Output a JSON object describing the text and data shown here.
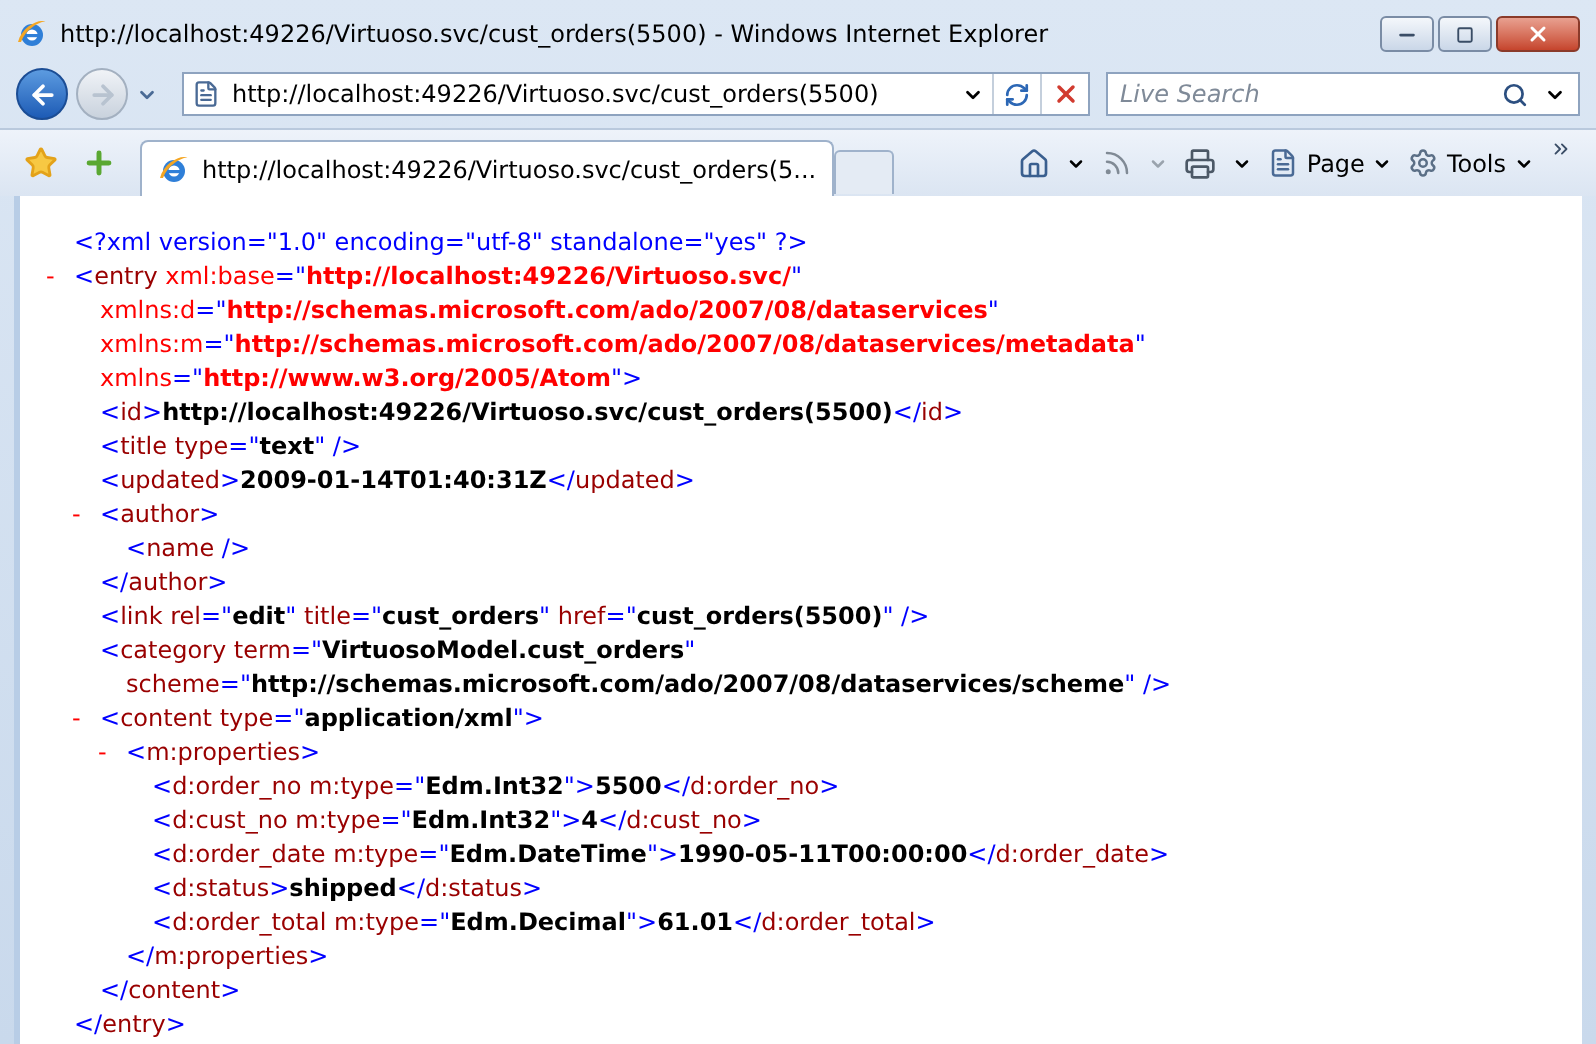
{
  "window": {
    "title": "http://localhost:49226/Virtuoso.svc/cust_orders(5500) - Windows Internet Explorer"
  },
  "address_bar": {
    "value": "http://localhost:49226/Virtuoso.svc/cust_orders(5500)"
  },
  "search": {
    "placeholder": "Live Search"
  },
  "tabs": [
    {
      "label": "http://localhost:49226/Virtuoso.svc/cust_orders(5...",
      "selected": true
    }
  ],
  "toolbar": {
    "page": "Page",
    "tools": "Tools"
  },
  "xml": [
    {
      "lines": [
        [
          {
            "kind": "p",
            "text": "<?xml version=\"1.0\" encoding=\"utf-8\" standalone=\"yes\" ?>"
          }
        ]
      ]
    },
    {
      "toggle": "-",
      "lines": [
        [
          {
            "kind": "p",
            "text": "<"
          },
          {
            "kind": "n",
            "text": "entry"
          },
          {
            "kind": "ns",
            "text": " xml:base"
          },
          {
            "kind": "p",
            "text": "=\""
          },
          {
            "kind": "nsv",
            "text": "http://localhost:49226/Virtuoso.svc/"
          },
          {
            "kind": "p",
            "text": "\""
          }
        ],
        [
          {
            "kind": "ns",
            "text": "xmlns:d"
          },
          {
            "kind": "p",
            "text": "=\""
          },
          {
            "kind": "nsv",
            "text": "http://schemas.microsoft.com/ado/2007/08/dataservices"
          },
          {
            "kind": "p",
            "text": "\""
          }
        ],
        [
          {
            "kind": "ns",
            "text": "xmlns:m"
          },
          {
            "kind": "p",
            "text": "=\""
          },
          {
            "kind": "nsv",
            "text": "http://schemas.microsoft.com/ado/2007/08/dataservices/metadata"
          },
          {
            "kind": "p",
            "text": "\""
          }
        ],
        [
          {
            "kind": "ns",
            "text": "xmlns"
          },
          {
            "kind": "p",
            "text": "=\""
          },
          {
            "kind": "nsv",
            "text": "http://www.w3.org/2005/Atom"
          },
          {
            "kind": "p",
            "text": "\">"
          }
        ]
      ],
      "children": [
        {
          "lines": [
            [
              {
                "kind": "p",
                "text": "<"
              },
              {
                "kind": "n",
                "text": "id"
              },
              {
                "kind": "p",
                "text": ">"
              },
              {
                "kind": "v",
                "text": "http://localhost:49226/Virtuoso.svc/cust_orders(5500)"
              },
              {
                "kind": "p",
                "text": "</"
              },
              {
                "kind": "n",
                "text": "id"
              },
              {
                "kind": "p",
                "text": ">"
              }
            ]
          ]
        },
        {
          "lines": [
            [
              {
                "kind": "p",
                "text": "<"
              },
              {
                "kind": "n",
                "text": "title"
              },
              {
                "kind": "n",
                "text": " type"
              },
              {
                "kind": "p",
                "text": "=\""
              },
              {
                "kind": "v",
                "text": "text"
              },
              {
                "kind": "p",
                "text": "\" />"
              }
            ]
          ]
        },
        {
          "lines": [
            [
              {
                "kind": "p",
                "text": "<"
              },
              {
                "kind": "n",
                "text": "updated"
              },
              {
                "kind": "p",
                "text": ">"
              },
              {
                "kind": "v",
                "text": "2009-01-14T01:40:31Z"
              },
              {
                "kind": "p",
                "text": "</"
              },
              {
                "kind": "n",
                "text": "updated"
              },
              {
                "kind": "p",
                "text": ">"
              }
            ]
          ]
        },
        {
          "toggle": "-",
          "lines": [
            [
              {
                "kind": "p",
                "text": "<"
              },
              {
                "kind": "n",
                "text": "author"
              },
              {
                "kind": "p",
                "text": ">"
              }
            ]
          ],
          "children": [
            {
              "lines": [
                [
                  {
                    "kind": "p",
                    "text": "<"
                  },
                  {
                    "kind": "n",
                    "text": "name"
                  },
                  {
                    "kind": "p",
                    "text": " />"
                  }
                ]
              ]
            }
          ],
          "close": [
            {
              "kind": "p",
              "text": "</"
            },
            {
              "kind": "n",
              "text": "author"
            },
            {
              "kind": "p",
              "text": ">"
            }
          ]
        },
        {
          "lines": [
            [
              {
                "kind": "p",
                "text": "<"
              },
              {
                "kind": "n",
                "text": "link"
              },
              {
                "kind": "n",
                "text": " rel"
              },
              {
                "kind": "p",
                "text": "=\""
              },
              {
                "kind": "v",
                "text": "edit"
              },
              {
                "kind": "p",
                "text": "\""
              },
              {
                "kind": "n",
                "text": " title"
              },
              {
                "kind": "p",
                "text": "=\""
              },
              {
                "kind": "v",
                "text": "cust_orders"
              },
              {
                "kind": "p",
                "text": "\""
              },
              {
                "kind": "n",
                "text": " href"
              },
              {
                "kind": "p",
                "text": "=\""
              },
              {
                "kind": "v",
                "text": "cust_orders(5500)"
              },
              {
                "kind": "p",
                "text": "\" />"
              }
            ]
          ]
        },
        {
          "lines": [
            [
              {
                "kind": "p",
                "text": "<"
              },
              {
                "kind": "n",
                "text": "category"
              },
              {
                "kind": "n",
                "text": " term"
              },
              {
                "kind": "p",
                "text": "=\""
              },
              {
                "kind": "v",
                "text": "VirtuosoModel.cust_orders"
              },
              {
                "kind": "p",
                "text": "\""
              }
            ],
            [
              {
                "kind": "n",
                "text": "scheme"
              },
              {
                "kind": "p",
                "text": "=\""
              },
              {
                "kind": "v",
                "text": "http://schemas.microsoft.com/ado/2007/08/dataservices/scheme"
              },
              {
                "kind": "p",
                "text": "\" />"
              }
            ]
          ]
        },
        {
          "toggle": "-",
          "lines": [
            [
              {
                "kind": "p",
                "text": "<"
              },
              {
                "kind": "n",
                "text": "content"
              },
              {
                "kind": "n",
                "text": " type"
              },
              {
                "kind": "p",
                "text": "=\""
              },
              {
                "kind": "v",
                "text": "application/xml"
              },
              {
                "kind": "p",
                "text": "\">"
              }
            ]
          ],
          "children": [
            {
              "toggle": "-",
              "lines": [
                [
                  {
                    "kind": "p",
                    "text": "<"
                  },
                  {
                    "kind": "n",
                    "text": "m:properties"
                  },
                  {
                    "kind": "p",
                    "text": ">"
                  }
                ]
              ],
              "children": [
                {
                  "lines": [
                    [
                      {
                        "kind": "p",
                        "text": "<"
                      },
                      {
                        "kind": "n",
                        "text": "d:order_no"
                      },
                      {
                        "kind": "n",
                        "text": " m:type"
                      },
                      {
                        "kind": "p",
                        "text": "=\""
                      },
                      {
                        "kind": "v",
                        "text": "Edm.Int32"
                      },
                      {
                        "kind": "p",
                        "text": "\">"
                      },
                      {
                        "kind": "v",
                        "text": "5500"
                      },
                      {
                        "kind": "p",
                        "text": "</"
                      },
                      {
                        "kind": "n",
                        "text": "d:order_no"
                      },
                      {
                        "kind": "p",
                        "text": ">"
                      }
                    ]
                  ]
                },
                {
                  "lines": [
                    [
                      {
                        "kind": "p",
                        "text": "<"
                      },
                      {
                        "kind": "n",
                        "text": "d:cust_no"
                      },
                      {
                        "kind": "n",
                        "text": " m:type"
                      },
                      {
                        "kind": "p",
                        "text": "=\""
                      },
                      {
                        "kind": "v",
                        "text": "Edm.Int32"
                      },
                      {
                        "kind": "p",
                        "text": "\">"
                      },
                      {
                        "kind": "v",
                        "text": "4"
                      },
                      {
                        "kind": "p",
                        "text": "</"
                      },
                      {
                        "kind": "n",
                        "text": "d:cust_no"
                      },
                      {
                        "kind": "p",
                        "text": ">"
                      }
                    ]
                  ]
                },
                {
                  "lines": [
                    [
                      {
                        "kind": "p",
                        "text": "<"
                      },
                      {
                        "kind": "n",
                        "text": "d:order_date"
                      },
                      {
                        "kind": "n",
                        "text": " m:type"
                      },
                      {
                        "kind": "p",
                        "text": "=\""
                      },
                      {
                        "kind": "v",
                        "text": "Edm.DateTime"
                      },
                      {
                        "kind": "p",
                        "text": "\">"
                      },
                      {
                        "kind": "v",
                        "text": "1990-05-11T00:00:00"
                      },
                      {
                        "kind": "p",
                        "text": "</"
                      },
                      {
                        "kind": "n",
                        "text": "d:order_date"
                      },
                      {
                        "kind": "p",
                        "text": ">"
                      }
                    ]
                  ]
                },
                {
                  "lines": [
                    [
                      {
                        "kind": "p",
                        "text": "<"
                      },
                      {
                        "kind": "n",
                        "text": "d:status"
                      },
                      {
                        "kind": "p",
                        "text": ">"
                      },
                      {
                        "kind": "v",
                        "text": "shipped"
                      },
                      {
                        "kind": "p",
                        "text": "</"
                      },
                      {
                        "kind": "n",
                        "text": "d:status"
                      },
                      {
                        "kind": "p",
                        "text": ">"
                      }
                    ]
                  ]
                },
                {
                  "lines": [
                    [
                      {
                        "kind": "p",
                        "text": "<"
                      },
                      {
                        "kind": "n",
                        "text": "d:order_total"
                      },
                      {
                        "kind": "n",
                        "text": " m:type"
                      },
                      {
                        "kind": "p",
                        "text": "=\""
                      },
                      {
                        "kind": "v",
                        "text": "Edm.Decimal"
                      },
                      {
                        "kind": "p",
                        "text": "\">"
                      },
                      {
                        "kind": "v",
                        "text": "61.01"
                      },
                      {
                        "kind": "p",
                        "text": "</"
                      },
                      {
                        "kind": "n",
                        "text": "d:order_total"
                      },
                      {
                        "kind": "p",
                        "text": ">"
                      }
                    ]
                  ]
                }
              ],
              "close": [
                {
                  "kind": "p",
                  "text": "</"
                },
                {
                  "kind": "n",
                  "text": "m:properties"
                },
                {
                  "kind": "p",
                  "text": ">"
                }
              ]
            }
          ],
          "close": [
            {
              "kind": "p",
              "text": "</"
            },
            {
              "kind": "n",
              "text": "content"
            },
            {
              "kind": "p",
              "text": ">"
            }
          ]
        }
      ],
      "close": [
        {
          "kind": "p",
          "text": "</"
        },
        {
          "kind": "n",
          "text": "entry"
        },
        {
          "kind": "p",
          "text": ">"
        }
      ]
    }
  ]
}
